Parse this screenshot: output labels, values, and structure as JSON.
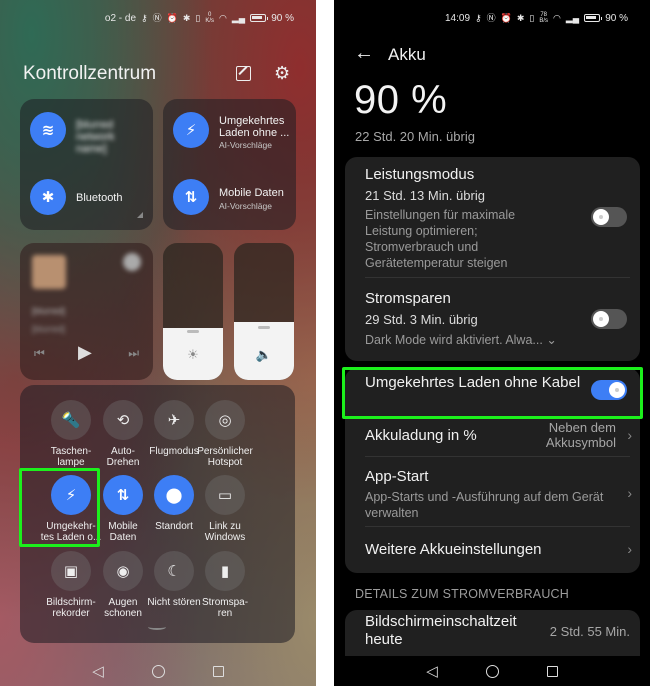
{
  "left": {
    "status": {
      "carrier": "o2 - de",
      "net_speed_value": "0",
      "net_speed_unit": "K/s",
      "battery": "90 %"
    },
    "title": "Kontrollzentrum",
    "header_icons": [
      "edit-icon",
      "settings-icon"
    ],
    "tiles": {
      "wifi": {
        "icon": "wifi-icon",
        "name": "[blurred network name]"
      },
      "bluetooth": {
        "icon": "bluetooth-icon",
        "label": "Bluetooth"
      },
      "reverse_charging": {
        "icon": "wireless-charging-icon",
        "label": "Umgekehrtes Laden ohne ...",
        "sub": "AI-Vorschläge"
      },
      "mobile_data": {
        "icon": "mobile-data-icon",
        "label": "Mobile Daten",
        "sub": "AI-Vorschläge"
      }
    },
    "media": {
      "title": "[blurred]",
      "artist": "[blurred]",
      "controls": [
        "previous",
        "play",
        "next"
      ]
    },
    "sliders": {
      "brightness": {
        "icon": "brightness-icon",
        "level_percent": 38
      },
      "volume": {
        "icon": "volume-icon",
        "level_percent": 42
      }
    },
    "toggles": [
      {
        "label": "Taschen-\nlampe",
        "icon": "flashlight-icon",
        "on": false
      },
      {
        "label": "Auto-\nDrehen",
        "icon": "auto-rotate-icon",
        "on": false
      },
      {
        "label": "Flugmodus",
        "icon": "airplane-icon",
        "on": false
      },
      {
        "label": "Persönlicher\nHotspot",
        "icon": "hotspot-icon",
        "on": false
      },
      {
        "label": "Umgekehr-\ntes Laden o...",
        "icon": "wireless-charging-icon",
        "on": true,
        "highlighted": true
      },
      {
        "label": "Mobile\nDaten",
        "icon": "mobile-data-icon",
        "on": true
      },
      {
        "label": "Standort",
        "icon": "location-icon",
        "on": true
      },
      {
        "label": "Link zu\nWindows",
        "icon": "link-windows-icon",
        "on": false
      },
      {
        "label": "Bildschirm-\nrekorder",
        "icon": "screen-recorder-icon",
        "on": false
      },
      {
        "label": "Augen\nschonen",
        "icon": "eye-comfort-icon",
        "on": false
      },
      {
        "label": "Nicht stören",
        "icon": "moon-icon",
        "on": false
      },
      {
        "label": "Stromspa-\nren",
        "icon": "power-saving-icon",
        "on": false
      }
    ]
  },
  "right": {
    "status": {
      "time": "14:09",
      "net_speed_value": "78",
      "net_speed_unit": "B/s",
      "battery": "90 %"
    },
    "title": "Akku",
    "battery_percent": "90 %",
    "remaining": "22 Std. 20 Min. übrig",
    "performance": {
      "title": "Leistungsmodus",
      "remaining": "21 Std. 13 Min. übrig",
      "desc": "Einstellungen für maximale Leistung optimieren; Stromverbrauch und Gerätetemperatur steigen",
      "on": false
    },
    "power_saving": {
      "title": "Stromsparen",
      "remaining": "29 Std. 3 Min. übrig",
      "desc": "Dark Mode wird aktiviert. Alwa...",
      "on": false
    },
    "reverse_charging": {
      "title": "Umgekehrtes Laden ohne Kabel",
      "on": true
    },
    "battery_pct_display": {
      "title": "Akkuladung in %",
      "value": "Neben dem Akkusymbol"
    },
    "app_start": {
      "title": "App-Start",
      "desc": "App-Starts und -Ausführung auf dem Gerät verwalten"
    },
    "more": {
      "title": "Weitere Akkueinstellungen"
    },
    "section": "DETAILS ZUM STROMVERBRAUCH",
    "screen_time": {
      "title": "Bildschirmeinschaltzeit heute",
      "value": "2 Std. 55 Min."
    }
  },
  "colors": {
    "accent": "#3d7ef5",
    "highlight": "#1cf01c"
  }
}
